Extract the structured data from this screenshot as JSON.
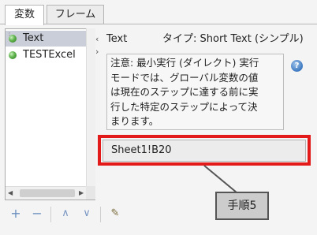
{
  "tabs": [
    {
      "label": "変数",
      "active": true
    },
    {
      "label": "フレーム",
      "active": false
    }
  ],
  "variables": [
    {
      "label": "Text",
      "selected": true,
      "icon": "green-ball-icon"
    },
    {
      "label": "TESTExcel",
      "selected": false,
      "icon": "green-ball-icon"
    }
  ],
  "toolbar": {
    "add_icon": "+",
    "remove_icon": "−",
    "up_icon": "∧",
    "down_icon": "∨",
    "edit_icon": "✎"
  },
  "detail": {
    "name": "Text",
    "type_line": "タイプ: Short Text (シンプル)",
    "note_lines": [
      "注意: 最小実行 (ダイレクト) 実行",
      "モードでは、グローバル変数の値",
      "は現在のステップに達する前に実",
      "行した特定のステップによって決",
      "まります。"
    ],
    "help_label": "?",
    "value": "Sheet1!B20"
  },
  "callout": {
    "label": "手順5"
  },
  "colors": {
    "highlight": "#e21a1a",
    "selection": "#c9ced9"
  }
}
